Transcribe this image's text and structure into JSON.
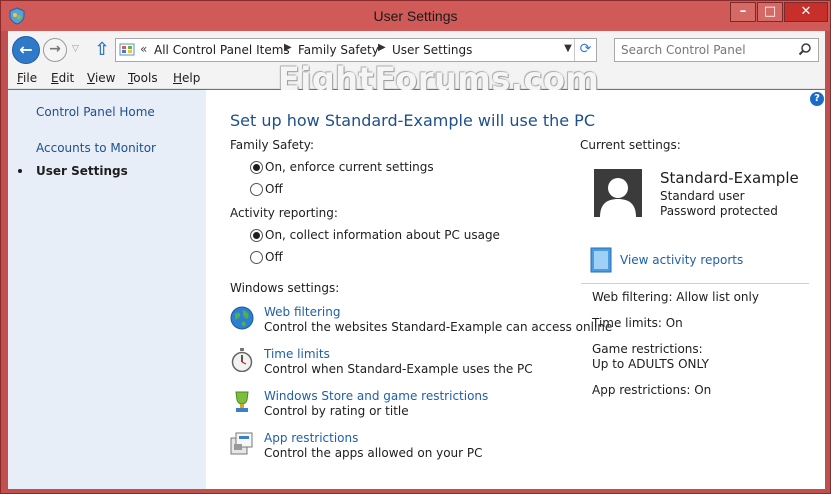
{
  "window": {
    "title": "User Settings"
  },
  "address": {
    "crumbs": [
      "All Control Panel Items",
      "Family Safety",
      "User Settings"
    ]
  },
  "search": {
    "placeholder": "Search Control Panel"
  },
  "menu": [
    {
      "key": "F",
      "rest": "ile"
    },
    {
      "key": "E",
      "rest": "dit"
    },
    {
      "key": "V",
      "rest": "iew"
    },
    {
      "key": "T",
      "rest": "ools"
    },
    {
      "key": "H",
      "rest": "elp"
    }
  ],
  "watermark": "EightForums.com",
  "sidebar": {
    "home": "Control Panel Home",
    "accounts": "Accounts to Monitor",
    "current": "User Settings"
  },
  "main": {
    "title": "Set up how Standard-Example will use the PC",
    "family_safety_label": "Family Safety:",
    "family_on": "On, enforce current settings",
    "family_off": "Off",
    "activity_label": "Activity reporting:",
    "activity_on": "On, collect information about PC usage",
    "activity_off": "Off",
    "windows_settings_label": "Windows settings:",
    "items": [
      {
        "title": "Web filtering",
        "desc": "Control the websites Standard-Example can access online"
      },
      {
        "title": "Time limits",
        "desc": "Control when Standard-Example uses the PC"
      },
      {
        "title": "Windows Store and game restrictions",
        "desc": "Control by rating or title"
      },
      {
        "title": "App restrictions",
        "desc": "Control the apps allowed on your PC"
      }
    ]
  },
  "current": {
    "label": "Current settings:",
    "name": "Standard-Example",
    "type": "Standard user",
    "password": "Password protected",
    "reports_link": "View activity reports",
    "web_filtering": "Web filtering:  Allow list only",
    "time_limits": "Time limits:  On",
    "game_label": "Game restrictions:",
    "game_value": "Up to ADULTS ONLY",
    "app_restrictions": "App restrictions:  On"
  },
  "colors": {
    "frame": "#c0504d",
    "link": "#1f5fa8",
    "sidebar": "#e8eef8"
  }
}
